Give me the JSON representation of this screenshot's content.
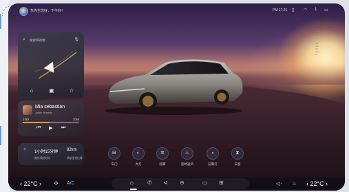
{
  "status": {
    "greeting": "朱先生您好，下午好！",
    "time": "PM 17:21"
  },
  "navigation": {
    "search_placeholder": "搜索目的地"
  },
  "music": {
    "title": "Mia sebastian",
    "artist": "Justin Hurwitz",
    "current_time": "1:50",
    "total_time": "3:54",
    "progress": 0.47
  },
  "range": {
    "time_value": "1小时15分钟",
    "distance_value": "82km",
    "time_caption": "剩余续航时间",
    "distance_caption": "续航里程估算"
  },
  "quick_controls": [
    {
      "label": "车门",
      "icon": "door-icon"
    },
    {
      "label": "大灯",
      "icon": "headlight-icon"
    },
    {
      "label": "除雾",
      "icon": "defog-icon"
    },
    {
      "label": "座椅通风",
      "icon": "seat-vent-icon"
    },
    {
      "label": "前雾灯",
      "icon": "fog-light-icon"
    },
    {
      "label": "天窗",
      "icon": "sunroof-icon"
    }
  ],
  "climate": {
    "left_temp": "22°C",
    "right_temp": "22°C",
    "ac_label": "A/C"
  },
  "colors": {
    "accent": "#f39a4a",
    "ac_blue": "#7fb6ff"
  }
}
